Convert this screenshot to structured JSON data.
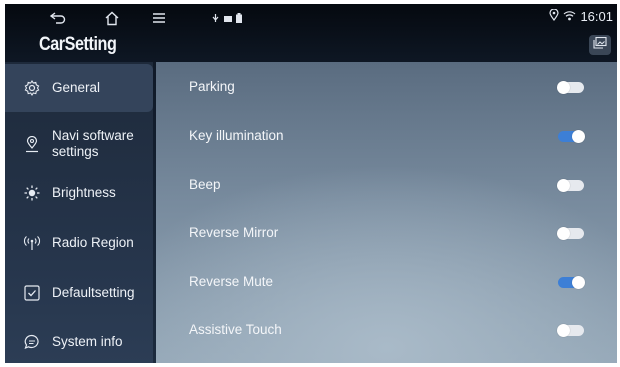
{
  "header": {
    "title": "CarSetting",
    "clock": "16:01",
    "nav": {
      "back_icon": "back-arrow-icon",
      "home_icon": "home-icon",
      "menu_icon": "menu-icon"
    },
    "status_icons": [
      "usb-icon",
      "sd-card-icon",
      "battery-icon"
    ],
    "right_icons": [
      "location-pin-icon",
      "wifi-icon"
    ],
    "corner_button_icon": "gallery-icon"
  },
  "sidebar": {
    "items": [
      {
        "label": "General",
        "icon": "gear-icon",
        "active": true
      },
      {
        "label": "Navi software settings",
        "icon": "map-pin-icon",
        "active": false
      },
      {
        "label": "Brightness",
        "icon": "sun-icon",
        "active": false
      },
      {
        "label": "Radio Region",
        "icon": "radio-antenna-icon",
        "active": false
      },
      {
        "label": "Defaultsetting",
        "icon": "checkbox-icon",
        "active": false
      },
      {
        "label": "System info",
        "icon": "chat-bubble-icon",
        "active": false
      }
    ]
  },
  "settings": [
    {
      "label": "Parking",
      "enabled": false
    },
    {
      "label": "Key illumination",
      "enabled": true
    },
    {
      "label": "Beep",
      "enabled": false
    },
    {
      "label": "Reverse Mirror",
      "enabled": false
    },
    {
      "label": "Reverse Mute",
      "enabled": true
    },
    {
      "label": "Assistive Touch",
      "enabled": false
    }
  ],
  "colors": {
    "toggle_on": "#3d7fd6",
    "toggle_off": "#e6e9ee",
    "accent_bg": "#34445b"
  }
}
